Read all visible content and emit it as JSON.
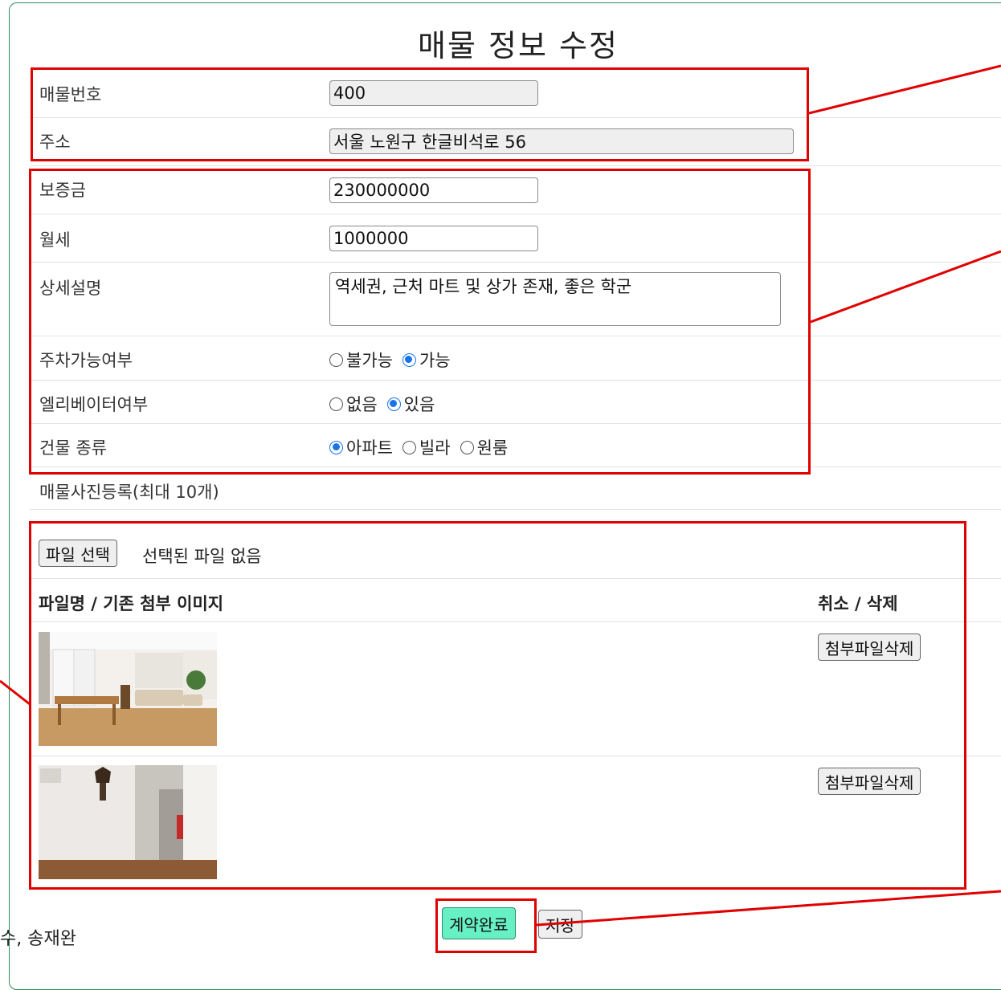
{
  "title": "매물 정보 수정",
  "fields": {
    "number": {
      "label": "매물번호",
      "value": "400"
    },
    "address": {
      "label": "주소",
      "value": "서울 노원구 한글비석로 56"
    },
    "deposit": {
      "label": "보증금",
      "value": "230000000"
    },
    "monthly": {
      "label": "월세",
      "value": "1000000"
    },
    "description": {
      "label": "상세설명",
      "value": "역세권, 근처 마트 및 상가 존재, 좋은 학군"
    },
    "parking": {
      "label": "주차가능여부",
      "options": [
        "불가능",
        "가능"
      ],
      "selected": "가능"
    },
    "elevator": {
      "label": "엘리베이터여부",
      "options": [
        "없음",
        "있음"
      ],
      "selected": "있음"
    },
    "building_type": {
      "label": "건물 종류",
      "options": [
        "아파트",
        "빌라",
        "원룸"
      ],
      "selected": "아파트"
    }
  },
  "photos": {
    "section_label": "매물사진등록(최대 10개)",
    "file_button": "파일 선택",
    "file_status": "선택된 파일 없음",
    "col_file": "파일명 / 기존 첨부 이미지",
    "col_action": "취소 / 삭제",
    "delete_label": "첨부파일삭제"
  },
  "buttons": {
    "complete": "계약완료",
    "save": "저장"
  },
  "footer": {
    "authors": "수, 송재완"
  },
  "colors": {
    "annotation": "#e00000",
    "complete_button": "#67f0c4",
    "card_border": "#2e8b57",
    "radio_selected": "#1a73e8"
  }
}
